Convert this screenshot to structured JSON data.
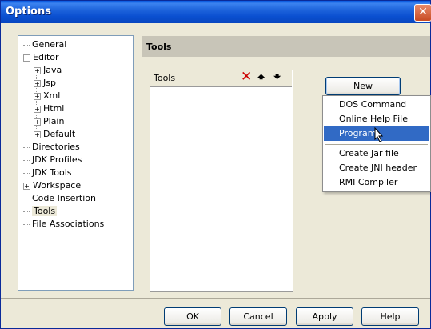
{
  "window": {
    "title": "Options",
    "close_glyph": "✕"
  },
  "tree": {
    "items": [
      {
        "label": "General",
        "level": 0,
        "expander": ""
      },
      {
        "label": "Editor",
        "level": 0,
        "expander": "-"
      },
      {
        "label": "Java",
        "level": 1,
        "expander": "+"
      },
      {
        "label": "Jsp",
        "level": 1,
        "expander": "+"
      },
      {
        "label": "Xml",
        "level": 1,
        "expander": "+"
      },
      {
        "label": "Html",
        "level": 1,
        "expander": "+"
      },
      {
        "label": "Plain",
        "level": 1,
        "expander": "+"
      },
      {
        "label": "Default",
        "level": 1,
        "expander": "+"
      },
      {
        "label": "Directories",
        "level": 0,
        "expander": ""
      },
      {
        "label": "JDK Profiles",
        "level": 0,
        "expander": ""
      },
      {
        "label": "JDK Tools",
        "level": 0,
        "expander": ""
      },
      {
        "label": "Workspace",
        "level": 0,
        "expander": "+"
      },
      {
        "label": "Code Insertion",
        "level": 0,
        "expander": ""
      },
      {
        "label": "Tools",
        "level": 0,
        "expander": "",
        "selected": true
      },
      {
        "label": "File Associations",
        "level": 0,
        "expander": ""
      }
    ]
  },
  "panel": {
    "header": "Tools"
  },
  "tools_list": {
    "label": "Tools",
    "delete_icon": "delete-icon",
    "up_icon": "arrow-up-icon",
    "down_icon": "arrow-down-icon"
  },
  "new_button": {
    "label": "New"
  },
  "new_menu": {
    "items": [
      "DOS Command",
      "Online Help File",
      "Program",
      "Create Jar file",
      "Create JNI header",
      "RMI Compiler"
    ],
    "highlighted": "Program"
  },
  "buttons": {
    "ok": "OK",
    "cancel": "Cancel",
    "apply": "Apply",
    "help": "Help"
  },
  "colors": {
    "title_bar": "#0a4fd0",
    "highlight": "#316ac5",
    "delete_red": "#cc0000"
  }
}
